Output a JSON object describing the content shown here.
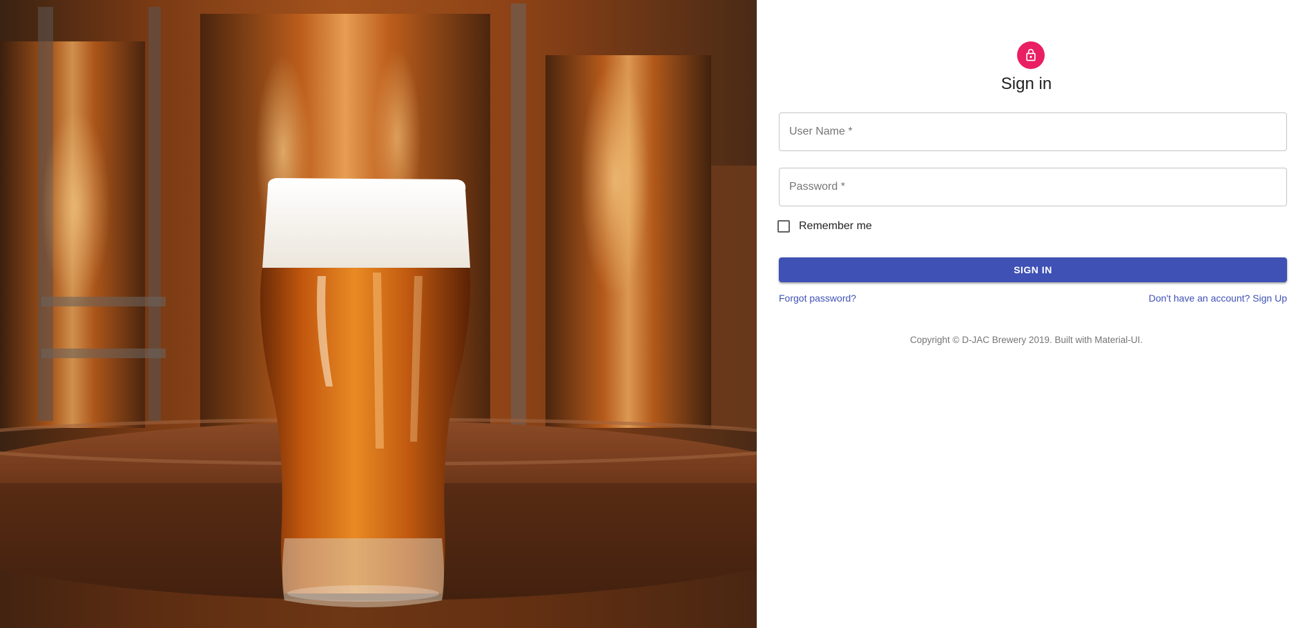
{
  "colors": {
    "accent": "#3f51b5",
    "avatar": "#e91e63",
    "text_secondary": "#757575"
  },
  "hero": {
    "image": "beer-glass-on-barrel-brewery-photo"
  },
  "header": {
    "icon": "lock-outlined-icon",
    "title": "Sign in"
  },
  "form": {
    "username_label": "User Name *",
    "username_value": "",
    "password_label": "Password *",
    "password_value": "",
    "remember_label": "Remember me",
    "remember_checked": false,
    "submit_label": "SIGN IN"
  },
  "links": {
    "forgot": "Forgot password?",
    "signup": "Don't have an account? Sign Up"
  },
  "footer": {
    "copyright": "Copyright © D-JAC Brewery 2019. Built with Material-UI."
  }
}
